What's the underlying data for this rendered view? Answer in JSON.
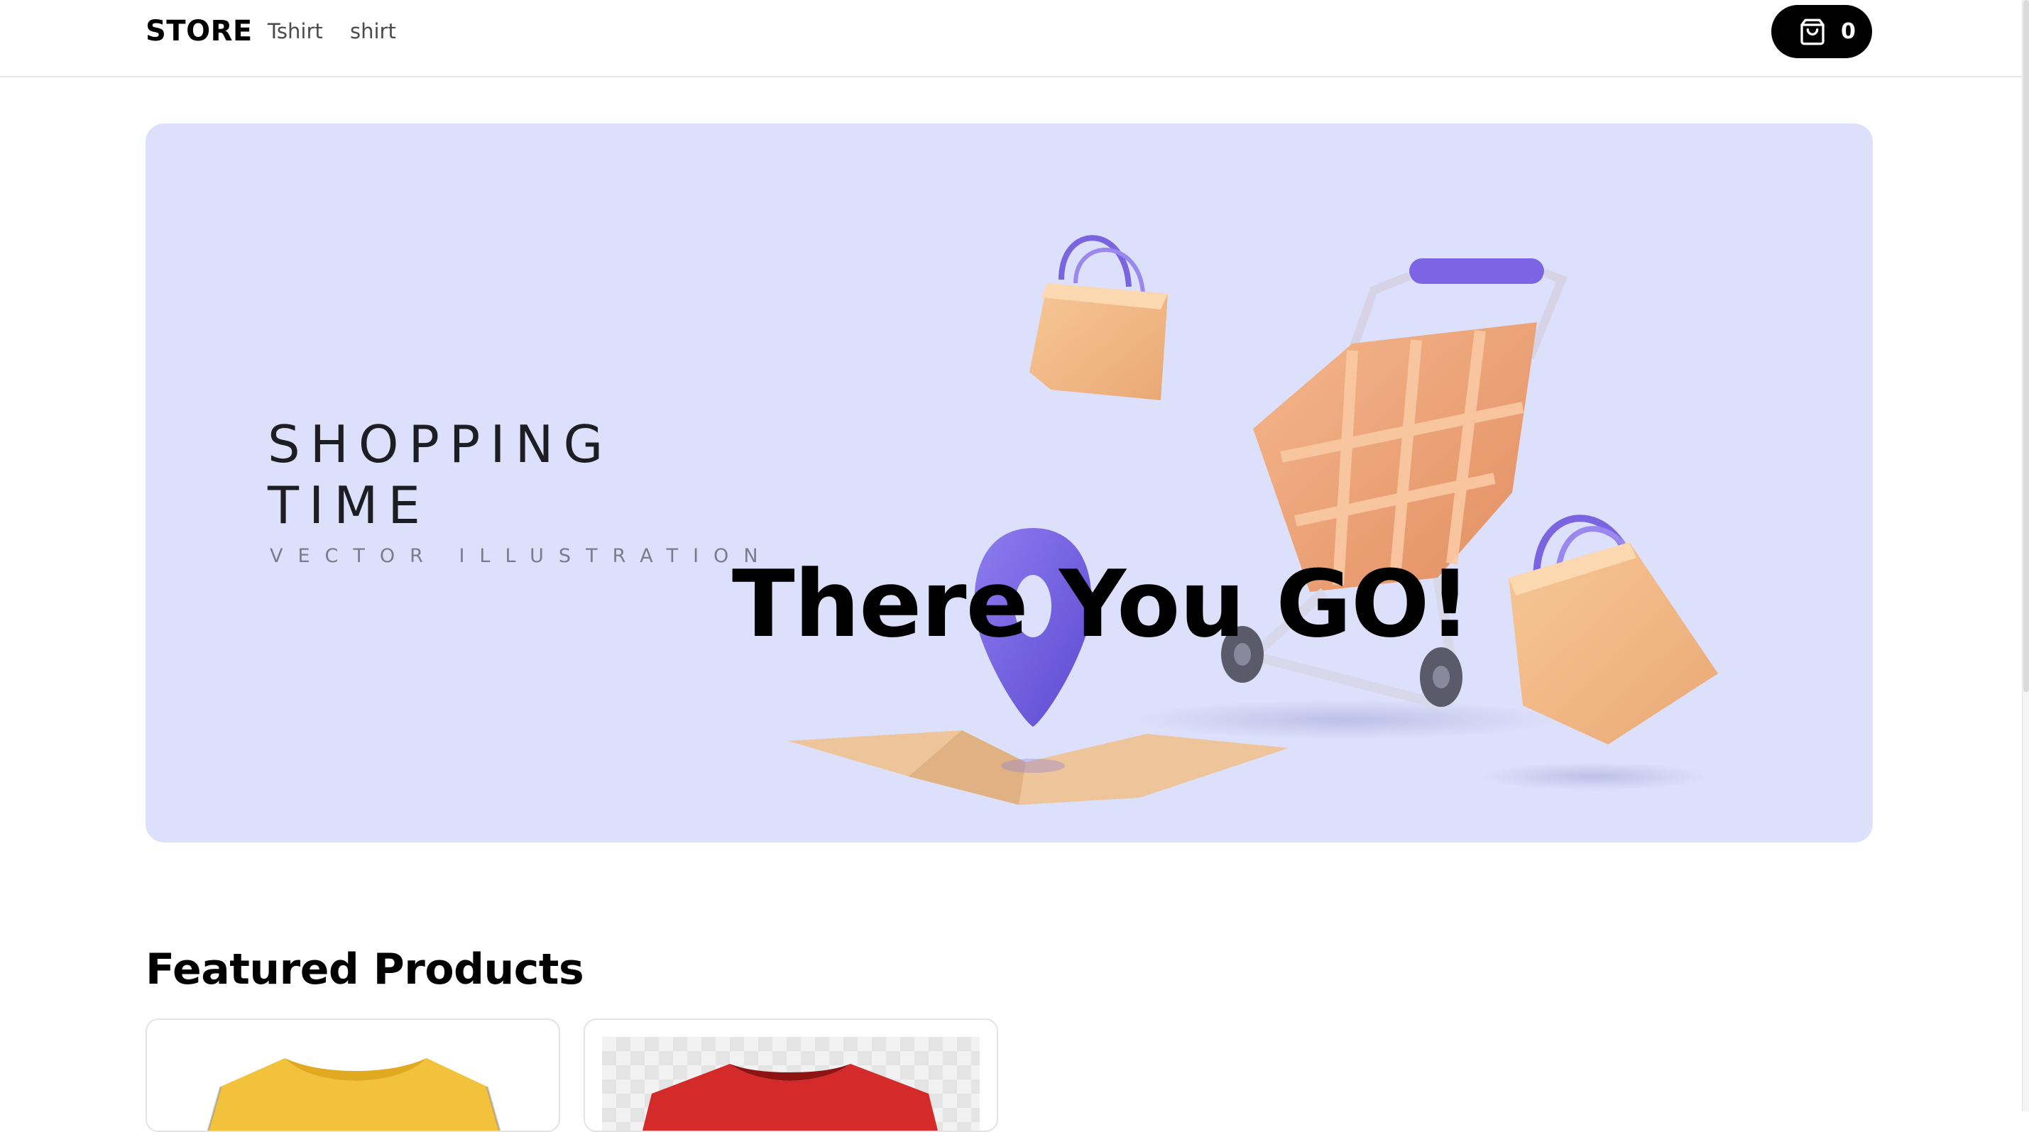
{
  "navbar": {
    "brand": "STORE",
    "links": [
      {
        "label": "Tshirt"
      },
      {
        "label": "shirt"
      }
    ],
    "cart": {
      "icon": "shopping-bag-icon",
      "count": "0"
    }
  },
  "billboard": {
    "title": "There You GO!",
    "image": {
      "text_lines": [
        "SHOPPING",
        "TIME",
        "VECTOR ILLUSTRATION"
      ],
      "background_color": "#dde0fa"
    }
  },
  "featured": {
    "title": "Featured Products",
    "products": [
      {
        "image": "yellow-tshirt-image",
        "color": "#f2c23c"
      },
      {
        "image": "red-tshirt-image",
        "color": "#d42a2a"
      }
    ]
  }
}
